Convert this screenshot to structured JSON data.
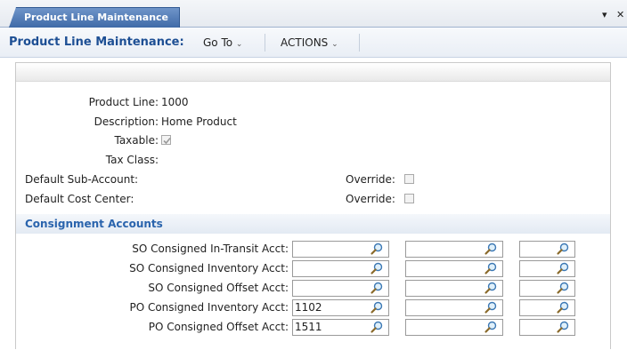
{
  "tab": {
    "label": "Product Line Maintenance",
    "menu_icon": "triangle-down-icon",
    "close_icon": "close-icon"
  },
  "toolbar": {
    "title": "Product Line Maintenance:",
    "goto_label": "Go To",
    "actions_label": "ACTIONS"
  },
  "form": {
    "product_line_label": "Product Line:",
    "product_line_value": "1000",
    "description_label": "Description:",
    "description_value": "Home Product",
    "taxable_label": "Taxable:",
    "taxable_checked": true,
    "tax_class_label": "Tax Class:",
    "default_sub_account_label": "Default Sub-Account:",
    "default_cost_center_label": "Default Cost Center:",
    "override_label": "Override:"
  },
  "section": {
    "title": "Consignment Accounts"
  },
  "accounts": [
    {
      "label": "SO Consigned In-Transit Acct:",
      "values": [
        "",
        "",
        ""
      ]
    },
    {
      "label": "SO Consigned Inventory Acct:",
      "values": [
        "",
        "",
        ""
      ]
    },
    {
      "label": "SO Consigned Offset Acct:",
      "values": [
        "",
        "",
        ""
      ]
    },
    {
      "label": "PO Consigned Inventory Acct:",
      "values": [
        "1102",
        "",
        ""
      ]
    },
    {
      "label": "PO Consigned Offset Acct:",
      "values": [
        "1511",
        "",
        ""
      ]
    }
  ]
}
